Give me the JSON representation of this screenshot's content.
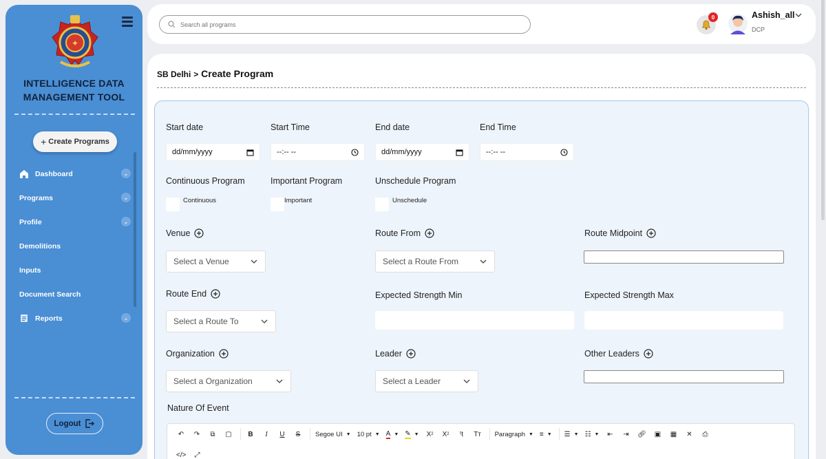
{
  "sidebar": {
    "brand_line1": "INTELLIGENCE DATA",
    "brand_line2": "MANAGEMENT TOOL",
    "create_label": "Create Programs",
    "items": [
      {
        "label": "Dashboard",
        "icon": "home-icon",
        "has_chevron": true
      },
      {
        "label": "Programs",
        "icon": "",
        "has_chevron": true
      },
      {
        "label": "Profile",
        "icon": "",
        "has_chevron": true
      },
      {
        "label": "Demolitions",
        "icon": "",
        "has_chevron": false
      },
      {
        "label": "Inputs",
        "icon": "",
        "has_chevron": false
      },
      {
        "label": "Document Search",
        "icon": "",
        "has_chevron": false
      },
      {
        "label": "Reports",
        "icon": "document-icon",
        "has_chevron": true
      }
    ],
    "logout_label": "Logout"
  },
  "topbar": {
    "search_placeholder": "Search all programs",
    "notification_count": "0",
    "user_name": "Ashish_all",
    "user_role": "DCP"
  },
  "page": {
    "breadcrumb_root": "SB Delhi",
    "breadcrumb_sep": ">",
    "title": "Create Program"
  },
  "form": {
    "start_date_label": "Start date",
    "start_date_value": "dd/mm/yyyy",
    "start_time_label": "Start Time",
    "start_time_value": "--:-- --",
    "end_date_label": "End date",
    "end_date_value": "dd/mm/yyyy",
    "end_time_label": "End Time",
    "end_time_value": "--:-- --",
    "continuous_label": "Continuous Program",
    "continuous_check": "Continuous",
    "important_label": "Important Program",
    "important_check": "Important",
    "unschedule_label": "Unschedule Program",
    "unschedule_check": "Unschedule",
    "venue_label": "Venue",
    "venue_placeholder": "Select a Venue",
    "route_from_label": "Route From",
    "route_from_placeholder": "Select a Route From",
    "route_mid_label": "Route Midpoint",
    "route_end_label": "Route End",
    "route_end_placeholder": "Select a Route To",
    "strength_min_label": "Expected Strength Min",
    "strength_max_label": "Expected Strength Max",
    "org_label": "Organization",
    "org_placeholder": "Select a Organization",
    "leader_label": "Leader",
    "leader_placeholder": "Select a Leader",
    "other_leaders_label": "Other Leaders",
    "nature_label": "Nature Of Event"
  },
  "editor": {
    "font_family": "Segoe UI",
    "font_size": "10 pt",
    "block_format": "Paragraph",
    "text_color": "#e0262a",
    "highlight_color": "#f2d21b"
  },
  "colors": {
    "sidebar": "#4a8ed4",
    "accent_border": "#a7c6e8",
    "form_bg": "#eef4fb",
    "badge": "#e0262a"
  }
}
